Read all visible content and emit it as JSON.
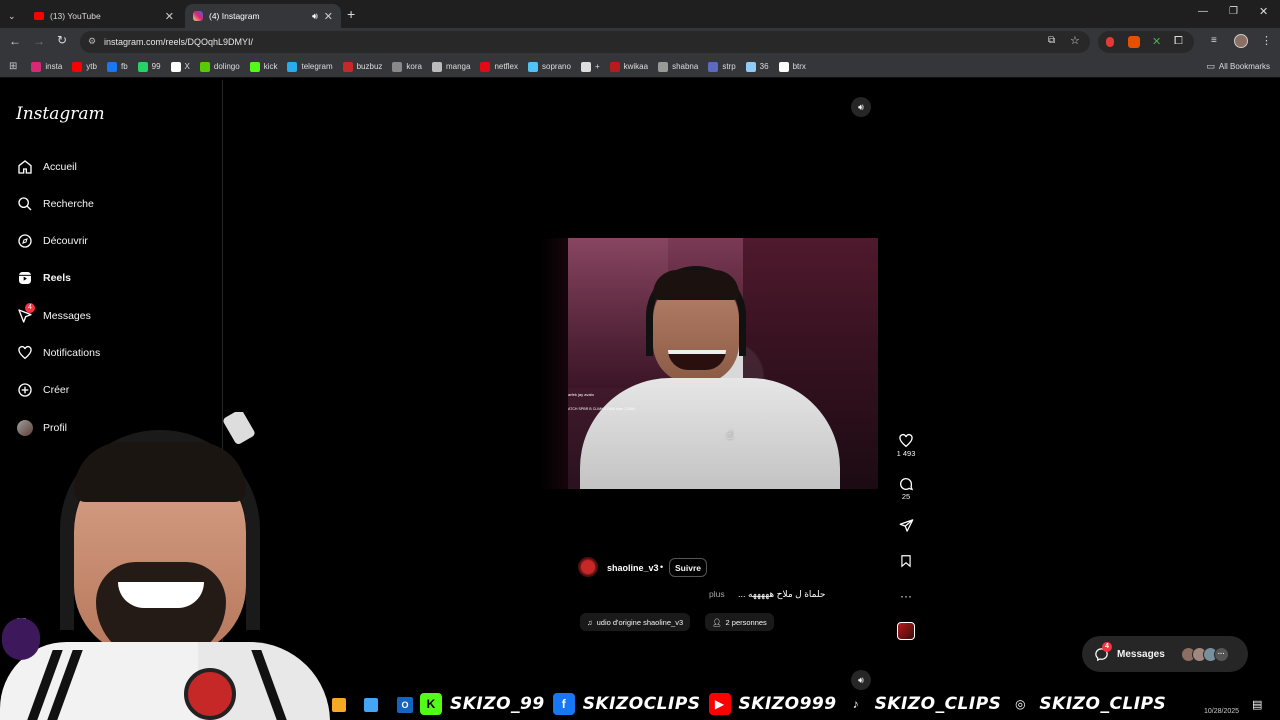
{
  "browser": {
    "tabs": [
      {
        "label": "(13) YouTube",
        "active": false,
        "icon": "youtube-icon"
      },
      {
        "label": "(4) Instagram",
        "active": true,
        "icon": "instagram-icon"
      }
    ],
    "url": "instagram.com/reels/DQOqhL9DMYI/",
    "bookmarks": [
      {
        "label": "insta",
        "color": "#d62976"
      },
      {
        "label": "ytb",
        "color": "#ff0000"
      },
      {
        "label": "fb",
        "color": "#1877f2"
      },
      {
        "label": "99",
        "color": "#25d366"
      },
      {
        "label": "X",
        "color": "#ffffff"
      },
      {
        "label": "dolingo",
        "color": "#58cc02"
      },
      {
        "label": "kick",
        "color": "#53fc18"
      },
      {
        "label": "telegram",
        "color": "#2aabee"
      },
      {
        "label": "buzbuz",
        "color": "#c62828"
      },
      {
        "label": "kora",
        "color": "#888888"
      },
      {
        "label": "manga",
        "color": "#bbbbbb"
      },
      {
        "label": "netflex",
        "color": "#e50914"
      },
      {
        "label": "soprano",
        "color": "#4fc3f7"
      },
      {
        "label": "+",
        "color": "#dddddd"
      },
      {
        "label": "kwikaa",
        "color": "#b71c1c"
      },
      {
        "label": "shabna",
        "color": "#999999"
      },
      {
        "label": "strp",
        "color": "#5c6bc0"
      },
      {
        "label": "36",
        "color": "#90caf9"
      },
      {
        "label": "btrx",
        "color": "#ffffff"
      }
    ],
    "all_bookmarks": "All Bookmarks"
  },
  "instagram": {
    "logo": "Instagram",
    "nav": [
      {
        "label": "Accueil",
        "icon": "home-icon"
      },
      {
        "label": "Recherche",
        "icon": "search-icon"
      },
      {
        "label": "Découvrir",
        "icon": "compass-icon"
      },
      {
        "label": "Reels",
        "icon": "reels-icon"
      },
      {
        "label": "Messages",
        "icon": "messenger-icon",
        "badge": "4"
      },
      {
        "label": "Notifications",
        "icon": "heart-icon"
      },
      {
        "label": "Créer",
        "icon": "plus-square-icon"
      },
      {
        "label": "Profil",
        "icon": "avatar-icon"
      }
    ],
    "reel": {
      "likes": "1 493",
      "comments": "25",
      "username": "shaoline_v3",
      "follow": "Suivre",
      "caption": "حلماة ل ملاح هههههه ...",
      "more": "plus",
      "audio": "udio d'origine  shaoline_v3",
      "people": "2 personnes",
      "video_text_1": "arfek jay avalo",
      "video_text_2": "ATCH SPBR B CLIMKS RAM time 7,2004"
    },
    "messages_pill": {
      "label": "Messages",
      "badge": "4"
    }
  },
  "stream_overlay": {
    "items": [
      {
        "text": "SKIZO_99",
        "icon": "K",
        "color": "#53fc18"
      },
      {
        "text": "SKIZOCLIPS",
        "icon": "f",
        "color": "#1877f2"
      },
      {
        "text": "SKIZO999",
        "icon": "▶",
        "color": "#ff0000"
      },
      {
        "text": "SKIZO_CLIPS",
        "icon": "♪",
        "color": "#000000"
      },
      {
        "text": "SKIZO_CLIPS",
        "icon": "◎",
        "color": "#000000"
      }
    ],
    "clock_date": "10/28/2025"
  }
}
